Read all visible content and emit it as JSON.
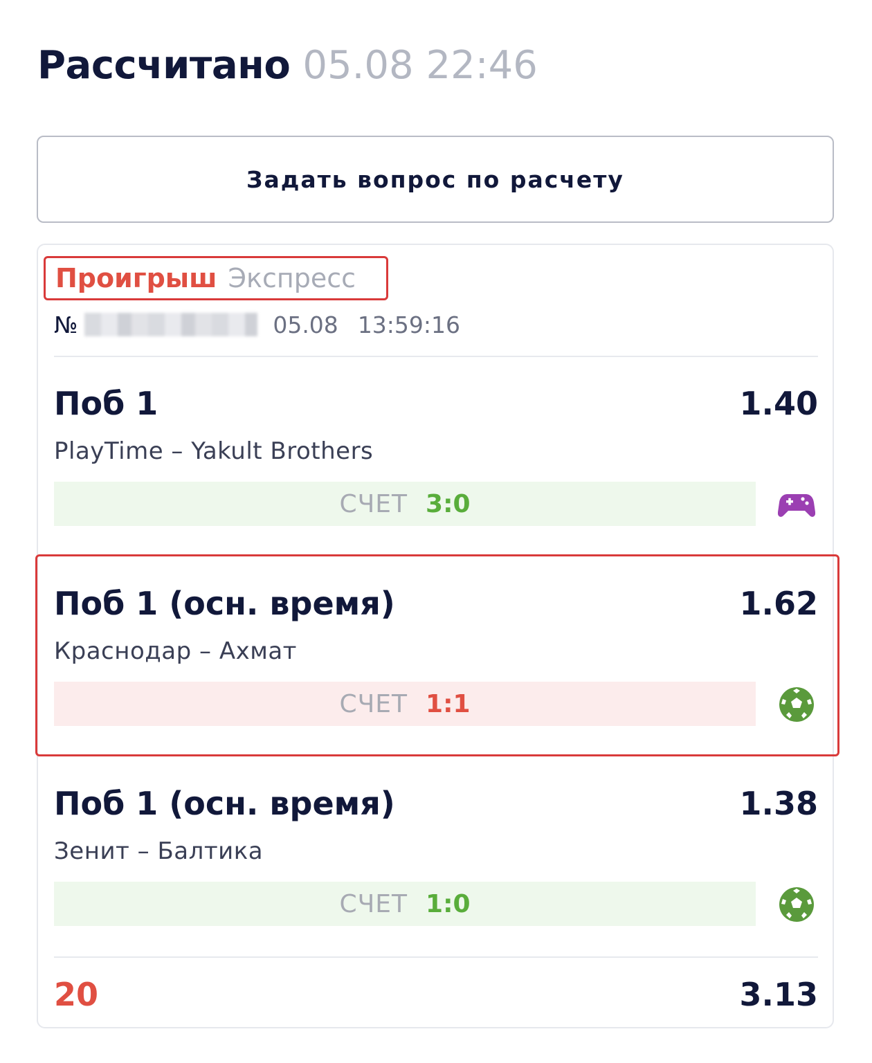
{
  "header": {
    "status_title": "Рассчитано",
    "status_time": "05.08 22:46"
  },
  "ask_button_label": "Задать вопрос по расчету",
  "bet": {
    "result_label": "Проигрыш",
    "bet_type": "Экспресс",
    "number_sign": "№",
    "date": "05.08",
    "time": "13:59:16"
  },
  "events": [
    {
      "market": "Поб 1",
      "odds": "1.40",
      "teams": "PlayTime – Yakult Brothers",
      "score_label": "СЧЕТ",
      "score": "3:0",
      "outcome": "win",
      "sport_icon": "gamepad-icon",
      "icon_color": "#9b3fb2"
    },
    {
      "market": "Поб 1 (осн. время)",
      "odds": "1.62",
      "teams": "Краснодар – Ахмат",
      "score_label": "СЧЕТ",
      "score": "1:1",
      "outcome": "lose",
      "sport_icon": "soccer-ball-icon",
      "icon_color": "#5a9a3c"
    },
    {
      "market": "Поб 1 (осн. время)",
      "odds": "1.38",
      "teams": "Зенит – Балтика",
      "score_label": "СЧЕТ",
      "score": "1:0",
      "outcome": "win",
      "sport_icon": "soccer-ball-icon",
      "icon_color": "#5a9a3c"
    }
  ],
  "footer": {
    "stake": "20",
    "total_odds": "3.13"
  },
  "colors": {
    "loss": "#e04f42",
    "win": "#59ad3b",
    "highlight_border": "#d93a3a",
    "text_dark": "#11183a",
    "text_muted": "#b3b7c2"
  }
}
